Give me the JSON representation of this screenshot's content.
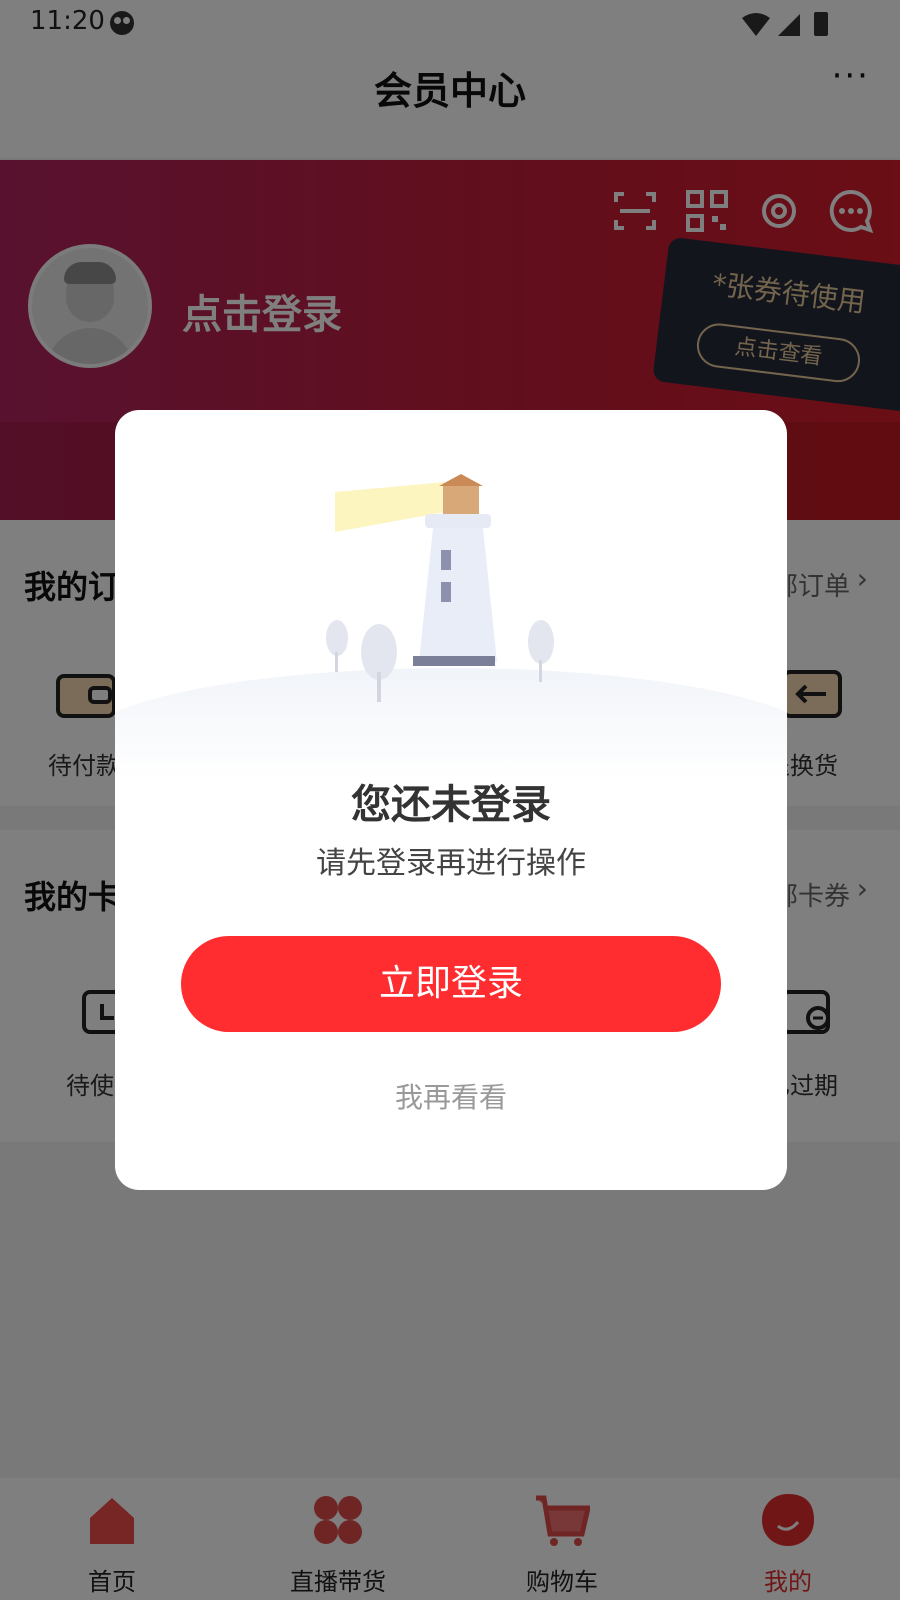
{
  "status_bar": {
    "time": "11:20"
  },
  "header": {
    "title": "会员中心",
    "more": "···"
  },
  "banner": {
    "login_link": "点击登录",
    "ticket_count_text": "*张券待使用",
    "ticket_view": "点击查看"
  },
  "orders": {
    "title": "我的订单",
    "more": "全部订单",
    "items": [
      "待付款",
      "退换货"
    ]
  },
  "cards": {
    "title": "我的卡券",
    "more": "全部卡券",
    "items": [
      "待使用",
      "已过期"
    ]
  },
  "tabbar": {
    "tabs": [
      {
        "label": "首页"
      },
      {
        "label": "直播带货"
      },
      {
        "label": "购物车"
      },
      {
        "label": "我的"
      }
    ],
    "active_color": "#e4393c"
  },
  "modal": {
    "title": "您还未登录",
    "subtitle": "请先登录再进行操作",
    "primary_button": "立即登录",
    "secondary_button": "我再看看"
  },
  "colors": {
    "accent": "#ff2c30",
    "banner_start": "#b1245f",
    "banner_end": "#d61d2b"
  }
}
